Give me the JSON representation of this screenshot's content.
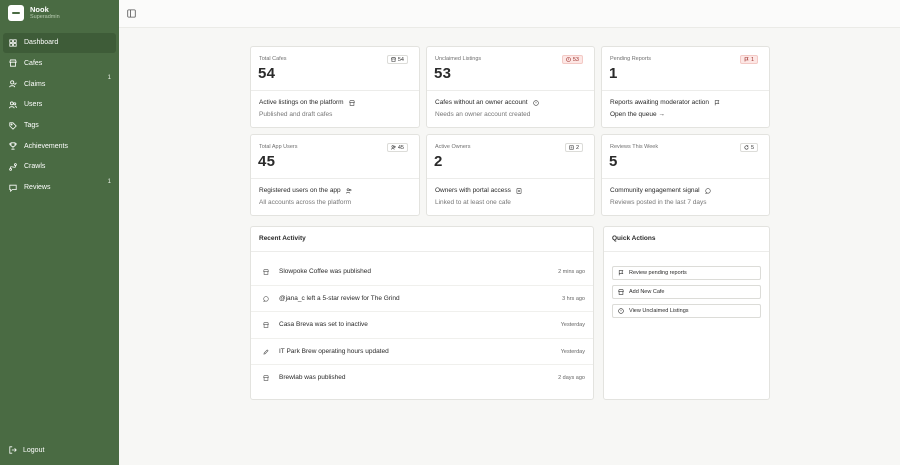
{
  "brand": {
    "name": "Nook",
    "subtitle": "Superadmin"
  },
  "nav": [
    {
      "label": "Dashboard",
      "icon": "home-icon",
      "active": true,
      "badge": ""
    },
    {
      "label": "Cafes",
      "icon": "store-icon",
      "active": false,
      "badge": ""
    },
    {
      "label": "Claims",
      "icon": "user-check-icon",
      "active": false,
      "badge": "1"
    },
    {
      "label": "Users",
      "icon": "users-icon",
      "active": false,
      "badge": ""
    },
    {
      "label": "Tags",
      "icon": "tag-icon",
      "active": false,
      "badge": ""
    },
    {
      "label": "Achievements",
      "icon": "trophy-icon",
      "active": false,
      "badge": ""
    },
    {
      "label": "Crawls",
      "icon": "route-icon",
      "active": false,
      "badge": ""
    },
    {
      "label": "Reviews",
      "icon": "message-icon",
      "active": false,
      "badge": "1"
    }
  ],
  "logout_label": "Logout",
  "stats": [
    {
      "label": "Total Cafes",
      "value": "54",
      "pill": "54",
      "pill_warn": false,
      "pill_icon": "store-icon",
      "heading": "Active listings on the platform",
      "heading_icon": "store-icon",
      "desc": "Published and draft cafes",
      "is_link": false
    },
    {
      "label": "Unclaimed Listings",
      "value": "53",
      "pill": "53",
      "pill_warn": true,
      "pill_icon": "alert-circle-icon",
      "heading": "Cafes without an owner account",
      "heading_icon": "alert-circle-icon",
      "desc": "Needs an owner account created",
      "is_link": false
    },
    {
      "label": "Pending Reports",
      "value": "1",
      "pill": "1",
      "pill_warn": true,
      "pill_icon": "flag-icon",
      "heading": "Reports awaiting moderator action",
      "heading_icon": "flag-icon",
      "desc": "Open the queue →",
      "is_link": true
    },
    {
      "label": "Total App Users",
      "value": "45",
      "pill": "45",
      "pill_warn": false,
      "pill_icon": "users-icon",
      "heading": "Registered users on the app",
      "heading_icon": "users-icon",
      "desc": "All accounts across the platform",
      "is_link": false
    },
    {
      "label": "Active Owners",
      "value": "2",
      "pill": "2",
      "pill_warn": false,
      "pill_icon": "id-card-icon",
      "heading": "Owners with portal access",
      "heading_icon": "id-card-icon",
      "desc": "Linked to at least one cafe",
      "is_link": false
    },
    {
      "label": "Reviews This Week",
      "value": "5",
      "pill": "5",
      "pill_warn": false,
      "pill_icon": "refresh-icon",
      "heading": "Community engagement signal",
      "heading_icon": "message-icon",
      "desc": "Reviews posted in the last 7 days",
      "is_link": false
    }
  ],
  "recent_activity": {
    "title": "Recent Activity",
    "items": [
      {
        "icon": "store-icon",
        "text": "Slowpoke Coffee was published",
        "time": "2 mins ago"
      },
      {
        "icon": "message-icon",
        "text": "@jana_c left a 5-star review for The Grind",
        "time": "3 hrs ago"
      },
      {
        "icon": "store-icon",
        "text": "Casa Breva was set to inactive",
        "time": "Yesterday"
      },
      {
        "icon": "pencil-icon",
        "text": "IT Park Brew operating hours updated",
        "time": "Yesterday"
      },
      {
        "icon": "store-icon",
        "text": "Brewlab was published",
        "time": "2 days ago"
      }
    ]
  },
  "quick_actions": {
    "title": "Quick Actions",
    "items": [
      {
        "icon": "flag-icon",
        "label": "Review pending reports"
      },
      {
        "icon": "store-icon",
        "label": "Add New Cafe"
      },
      {
        "icon": "alert-circle-icon",
        "label": "View Unclaimed Listings"
      }
    ]
  },
  "colors": {
    "sidebar": "#4a6b43",
    "sidebar_active": "#3e5c38",
    "warn_bg": "#fde7e5",
    "warn_text": "#9c2f2a"
  }
}
